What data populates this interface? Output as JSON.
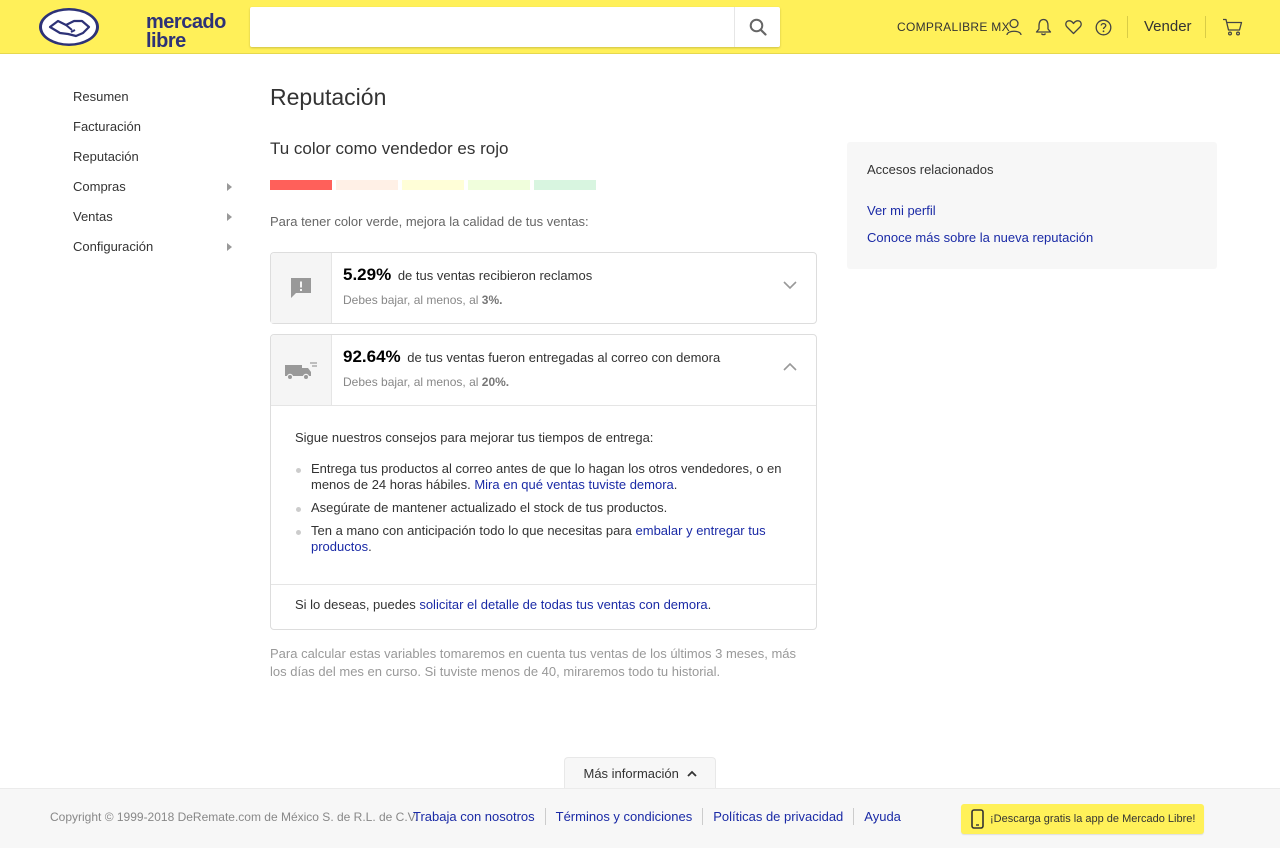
{
  "header": {
    "logo_text_line1": "mercado",
    "logo_text_line2": "libre",
    "search_placeholder": "",
    "user_name": "COMPRALIBRE MX",
    "sell_label": "Vender",
    "brand_color": "#fff059"
  },
  "sidebar": {
    "items": [
      {
        "label": "Resumen"
      },
      {
        "label": "Facturación"
      },
      {
        "label": "Reputación"
      },
      {
        "label": "Compras"
      },
      {
        "label": "Ventas"
      },
      {
        "label": "Configuración"
      }
    ]
  },
  "main": {
    "title": "Reputación",
    "color_heading": "Tu color como vendedor es rojo",
    "thermometer_colors": [
      "#ff605a",
      "#fff0e6",
      "#fffed7",
      "#f0fedc",
      "#d8f5e0"
    ],
    "intro": "Para tener color verde, mejora la calidad de tus ventas:",
    "claims": {
      "percent": "5.29%",
      "text": "de tus ventas recibieron reclamos",
      "target_prefix": "Debes bajar, al menos, al",
      "target_value": "3%."
    },
    "delays": {
      "percent": "92.64%",
      "text": "de tus ventas fueron entregadas al correo con demora",
      "target_prefix": "Debes bajar, al menos, al",
      "target_value": "20%.",
      "tips_title": "Sigue nuestros consejos para mejorar tus tiempos de entrega:",
      "tip1_text": "Entrega tus productos al correo antes de que lo hagan los otros vendedores, o en menos de 24 horas hábiles.",
      "tip1_link": "Mira en qué ventas tuviste demora",
      "tip2_text": "Asegúrate de mantener actualizado el stock de tus productos.",
      "tip3_text": "Ten a mano con anticipación todo lo que necesitas para",
      "tip3_link": "embalar y entregar tus productos",
      "footer_text": "Si lo deseas, puedes",
      "footer_link": "solicitar el detalle de todas tus ventas con demora"
    },
    "note": "Para calcular estas variables tomaremos en cuenta tus ventas de los últimos 3 meses, más los días del mes en curso. Si tuviste menos de 40, miraremos todo tu historial."
  },
  "related": {
    "title": "Accesos relacionados",
    "link1": "Ver mi perfil",
    "link2": "Conoce más sobre la nueva reputación"
  },
  "footer": {
    "more_info": "Más información",
    "copyright": "Copyright © 1999-2018 DeRemate.com de México S. de R.L. de C.V.",
    "links": [
      "Trabaja con nosotros",
      "Términos y condiciones",
      "Políticas de privacidad",
      "Ayuda"
    ],
    "app_button": "¡Descarga gratis la app de Mercado Libre!"
  }
}
